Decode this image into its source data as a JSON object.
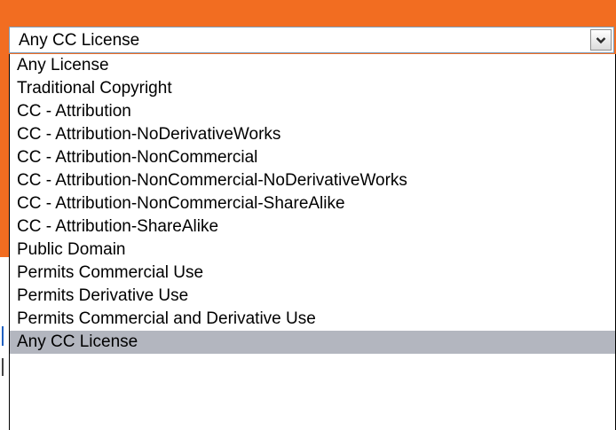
{
  "colors": {
    "accent_orange": "#f26d21",
    "selected_row": "#b3b6bf",
    "border": "#7f9db9"
  },
  "select": {
    "current_value": "Any CC License",
    "arrow_icon": "chevron-down-icon"
  },
  "options": [
    {
      "label": "Any License"
    },
    {
      "label": "Traditional Copyright"
    },
    {
      "label": "CC - Attribution"
    },
    {
      "label": "CC - Attribution-NoDerivativeWorks"
    },
    {
      "label": "CC - Attribution-NonCommercial"
    },
    {
      "label": "CC - Attribution-NonCommercial-NoDerivativeWorks"
    },
    {
      "label": "CC - Attribution-NonCommercial-ShareAlike"
    },
    {
      "label": "CC - Attribution-ShareAlike"
    },
    {
      "label": "Public Domain"
    },
    {
      "label": "Permits Commercial Use"
    },
    {
      "label": "Permits Derivative Use"
    },
    {
      "label": "Permits Commercial and Derivative Use"
    },
    {
      "label": "Any CC License",
      "selected": true
    }
  ]
}
